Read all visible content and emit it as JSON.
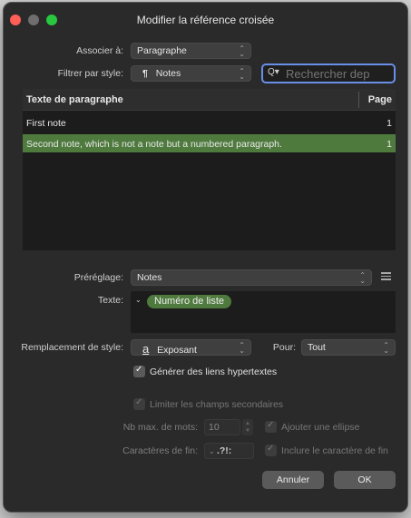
{
  "window": {
    "title": "Modifier la référence croisée"
  },
  "associer": {
    "label": "Associer à:",
    "value": "Paragraphe"
  },
  "filtrer": {
    "label": "Filtrer par style:",
    "icon": "pilcrow-icon",
    "icon_glyph": "¶",
    "value": "Notes"
  },
  "search": {
    "icon_glyph": "Q▾",
    "placeholder": "Rechercher dep"
  },
  "table": {
    "col_text": "Texte de paragraphe",
    "col_page": "Page",
    "rows": [
      {
        "text": "First note",
        "page": "1",
        "selected": false
      },
      {
        "text": "Second note, which is not a note but a numbered paragraph.",
        "page": "1",
        "selected": true
      }
    ]
  },
  "preset": {
    "label": "Préréglage:",
    "value": "Notes"
  },
  "texte": {
    "label": "Texte:",
    "disclosure": "⌄",
    "token": "Numéro de liste"
  },
  "style_replace": {
    "label": "Remplacement de style:",
    "icon_glyph": "a",
    "value": "Exposant"
  },
  "pour": {
    "label": "Pour:",
    "value": "Tout"
  },
  "hyperlinks": {
    "label": "Générer des liens hypertextes",
    "checked": true
  },
  "limit_fields": {
    "label": "Limiter les champs secondaires",
    "checked": true
  },
  "max_words": {
    "label": "Nb max. de mots:",
    "value": "10"
  },
  "ellipsis": {
    "label": "Ajouter une ellipse",
    "checked": true
  },
  "end_chars": {
    "label": "Caractères de fin:",
    "value": ".?!:"
  },
  "include_end": {
    "label": "Inclure le caractère de fin",
    "checked": true
  },
  "buttons": {
    "cancel": "Annuler",
    "ok": "OK"
  },
  "colors": {
    "selection": "#4f7a3e",
    "focus_ring": "#6a8fe8",
    "close": "#fe5f57",
    "maximize": "#28c840"
  }
}
